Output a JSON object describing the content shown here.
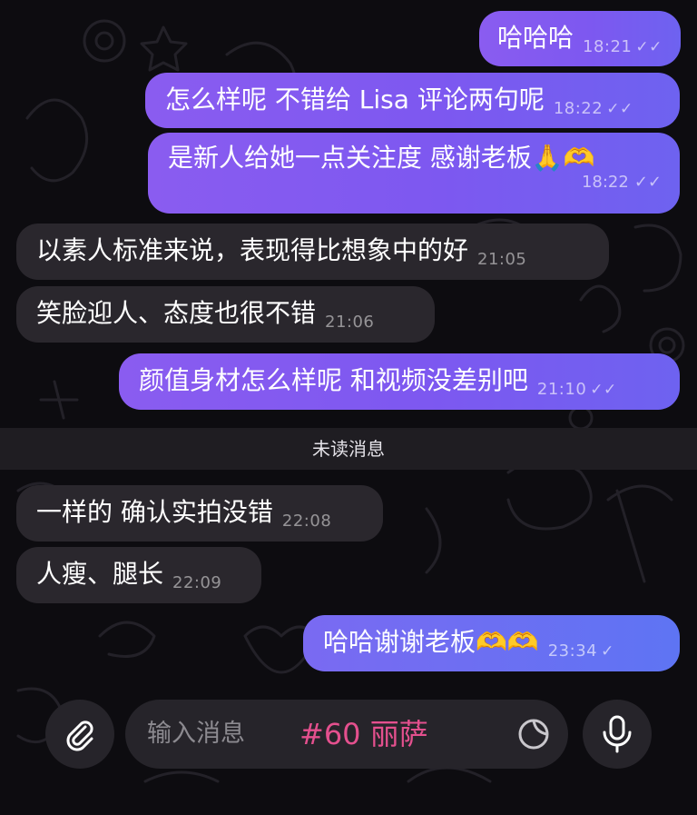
{
  "messages": [
    {
      "text": "哈哈哈",
      "time": "18:21",
      "status": "✓✓"
    },
    {
      "text": "怎么样呢 不错给 Lisa 评论两句呢",
      "time": "18:22",
      "status": "✓✓"
    },
    {
      "text": "是新人给她一点关注度 感谢老板🙏🫶",
      "time": "18:22",
      "status": "✓✓"
    },
    {
      "text": "以素人标准来说，表现得比想象中的好",
      "time": "21:05"
    },
    {
      "text": "笑脸迎人、态度也很不错",
      "time": "21:06"
    },
    {
      "text": "颜值身材怎么样呢 和视频没差别吧",
      "time": "21:10",
      "status": "✓✓"
    },
    {
      "text": "一样的 确认实拍没错",
      "time": "22:08"
    },
    {
      "text": "人瘦、腿长",
      "time": "22:09"
    },
    {
      "text": "哈哈谢谢老板🫶🫶",
      "time": "23:34",
      "status": "✓"
    }
  ],
  "unread_divider": "未读消息",
  "composer": {
    "placeholder": "输入消息",
    "overlay_caption": "#60 丽萨",
    "attach_icon": "paperclip-icon",
    "sticker_icon": "sticker-icon",
    "mic_icon": "microphone-icon"
  },
  "colors": {
    "outgoing": "#7d58f0",
    "outgoing_last": "#5e74f3",
    "incoming": "#2a272d",
    "background": "#0d0c10",
    "caption": "#e4508e"
  }
}
